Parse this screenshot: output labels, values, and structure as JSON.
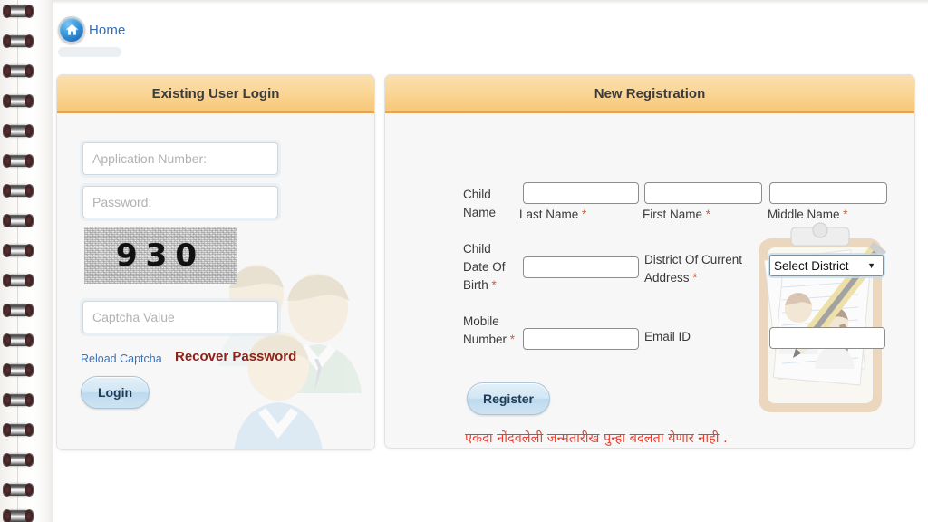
{
  "nav": {
    "home_label": "Home",
    "home_icon": "home-icon"
  },
  "login_panel": {
    "title": "Existing User Login",
    "application_number": {
      "value": "",
      "placeholder": "Application Number:"
    },
    "password": {
      "value": "",
      "placeholder": "Password:"
    },
    "captcha": {
      "text": "930",
      "image_name": "captcha-image"
    },
    "captcha_value": {
      "value": "",
      "placeholder": "Captcha Value"
    },
    "reload_captcha_label": "Reload Captcha",
    "recover_password_label": "Recover Password",
    "login_button_label": "Login"
  },
  "registration_panel": {
    "title": "New Registration",
    "child_name_label": "Child Name",
    "last_name": {
      "label": "Last Name",
      "required": "*",
      "value": ""
    },
    "first_name": {
      "label": "First Name",
      "required": "*",
      "value": ""
    },
    "middle_name": {
      "label": "Middle Name",
      "required": "*",
      "value": ""
    },
    "dob_label": "Child Date Of Birth",
    "dob_required": "*",
    "dob": {
      "value": ""
    },
    "district_label": "District Of Current Address",
    "district_required": "*",
    "district_select": {
      "selected": "Select District",
      "options": [
        "Select District"
      ]
    },
    "mobile_label": "Mobile Number",
    "mobile_required": "*",
    "mobile": {
      "value": ""
    },
    "email_label": "Email ID",
    "email": {
      "value": ""
    },
    "register_button_label": "Register",
    "note": "एकदा नोंदवलेली जन्मतारीख पुन्हा बदलता येणार नाही ."
  },
  "colors": {
    "header_amber": "#f8cd84",
    "header_border": "#f0a04b",
    "link_blue": "#3a72b8",
    "recover_maroon": "#8c2318",
    "required_orange": "#e2562a",
    "note_red": "#ef3b2c",
    "button_blue": "#cfe4f2"
  }
}
